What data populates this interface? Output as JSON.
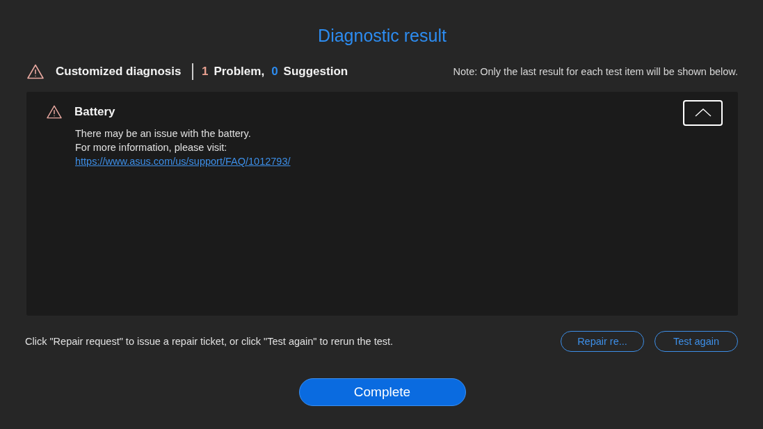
{
  "title": "Diagnostic result",
  "summary": {
    "label": "Customized diagnosis",
    "problems_count": "1",
    "problems_label": "Problem,",
    "suggestions_count": "0",
    "suggestions_label": "Suggestion",
    "note": "Note: Only the last result for each test item will be shown below."
  },
  "results": [
    {
      "name": "Battery",
      "expanded": true,
      "lines": [
        "There may be an issue with the battery.",
        "For more information, please visit:"
      ],
      "link": "https://www.asus.com/us/support/FAQ/1012793/"
    }
  ],
  "footer": {
    "hint": "Click \"Repair request\" to issue a repair ticket, or click \"Test again\" to rerun the test.",
    "buttons": [
      "Repair re...",
      "Test again"
    ]
  },
  "complete_button": "Complete"
}
